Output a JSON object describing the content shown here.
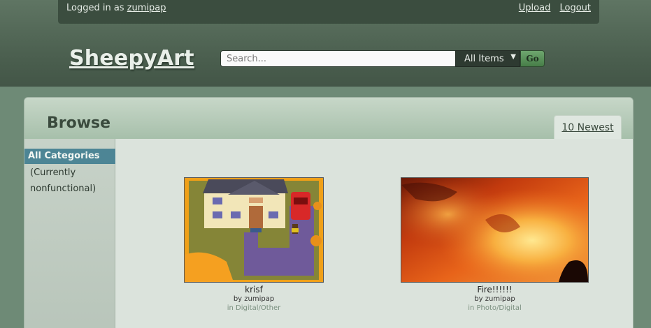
{
  "userbar": {
    "logged_prefix": "Logged in as",
    "username": "zumipap",
    "upload": "Upload",
    "logout": "Logout"
  },
  "site": {
    "logo": "SheepyArt"
  },
  "search": {
    "placeholder": "Search...",
    "value": "",
    "scope": "All Items",
    "go": "Go"
  },
  "browse": {
    "title": "Browse",
    "tab": "10 Newest",
    "categories": {
      "active": "All Categories",
      "note": "(Currently nonfunctional)"
    },
    "items": [
      {
        "title": "krisf",
        "by": "by zumipap",
        "category": "in Digital/Other",
        "thumb_icon": "house-pixel-art"
      },
      {
        "title": "Fire!!!!!!",
        "by": "by zumipap",
        "category": "in Photo/Digital",
        "thumb_icon": "fire-photo"
      }
    ]
  },
  "colors": {
    "header": "#4a5e4e",
    "accent_category": "#4d8595",
    "go_button": "#477e48"
  }
}
